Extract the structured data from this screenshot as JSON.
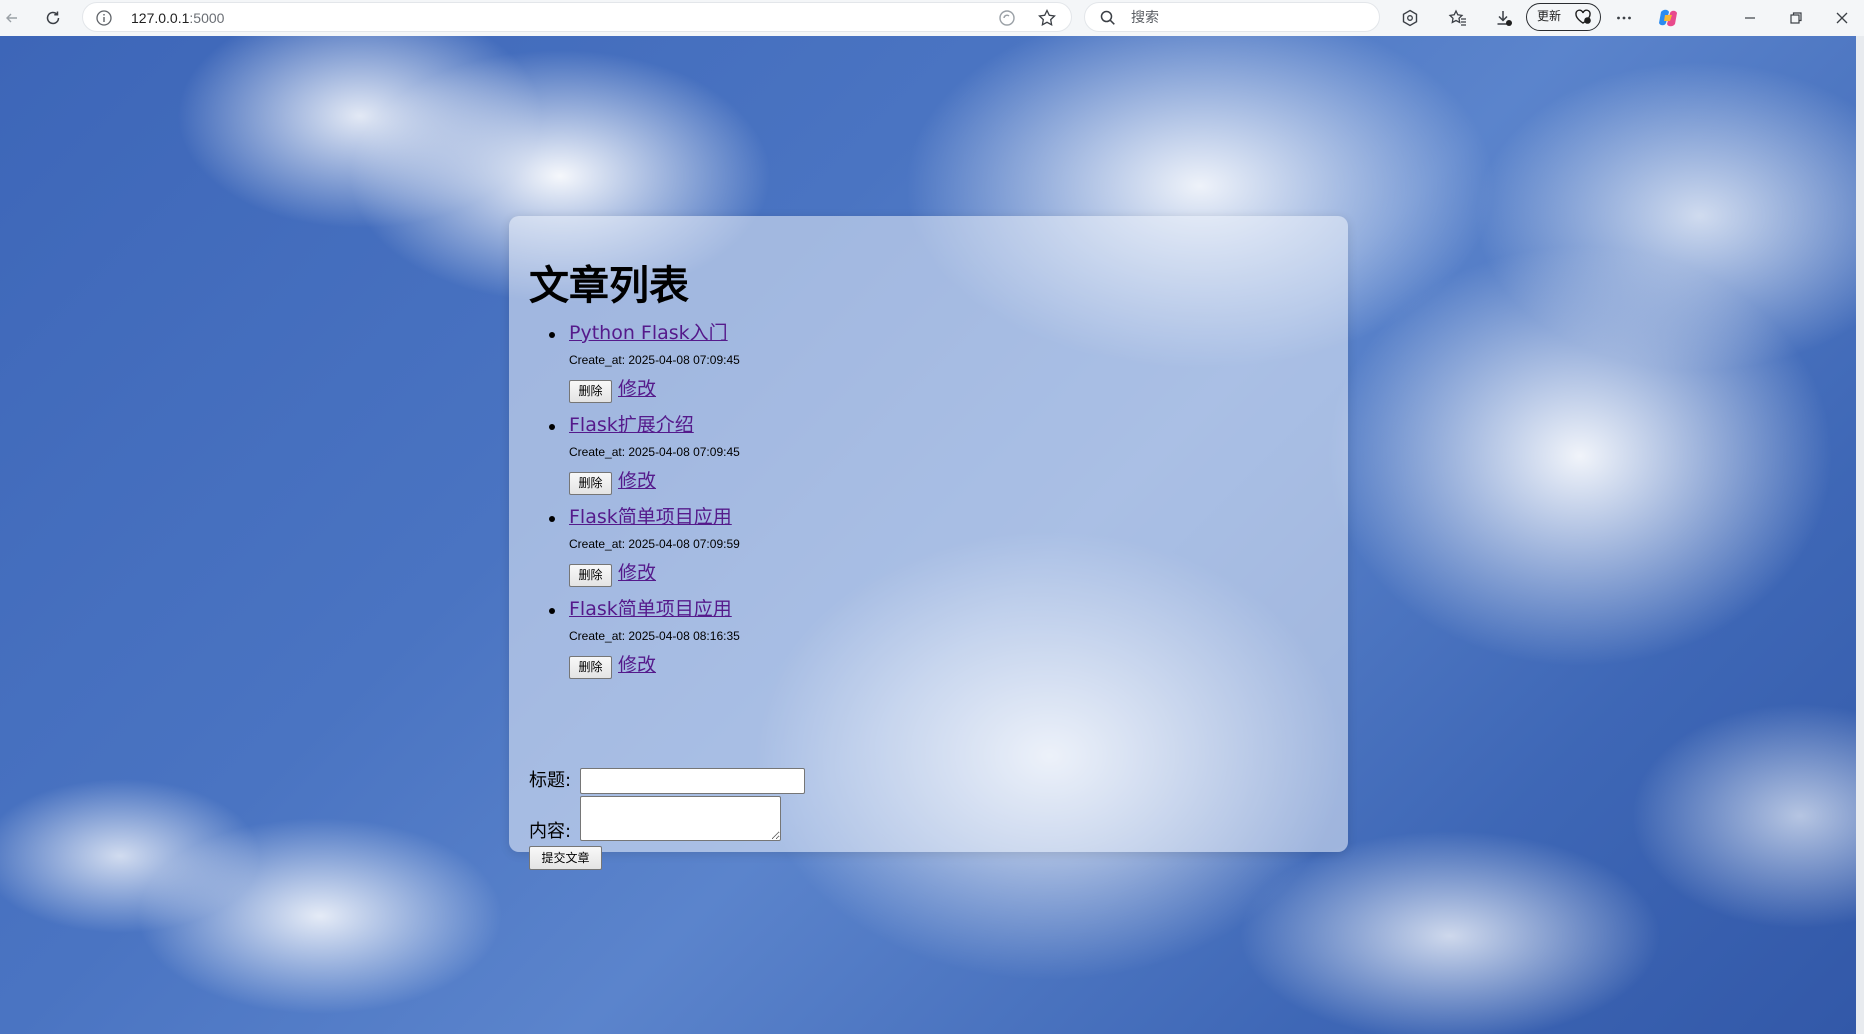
{
  "browser": {
    "address": {
      "host": "127.0.0.1",
      "port": ":5000"
    },
    "search_placeholder": "搜索",
    "update_label": "更新"
  },
  "page": {
    "title": "文章列表",
    "articles": [
      {
        "title": "Python Flask入门",
        "created_at": "Create_at: 2025-04-08 07:09:45",
        "delete_label": "删除",
        "edit_label": "修改"
      },
      {
        "title": "Flask扩展介绍",
        "created_at": "Create_at: 2025-04-08 07:09:45",
        "delete_label": "删除",
        "edit_label": "修改"
      },
      {
        "title": "Flask简单项目应用",
        "created_at": "Create_at: 2025-04-08 07:09:59",
        "delete_label": "删除",
        "edit_label": "修改"
      },
      {
        "title": "Flask简单项目应用",
        "created_at": "Create_at: 2025-04-08 08:16:35",
        "delete_label": "删除",
        "edit_label": "修改"
      }
    ],
    "form": {
      "title_label": "标题:",
      "title_value": "",
      "content_label": "内容:",
      "content_value": "",
      "submit_label": "提交文章"
    }
  },
  "colors": {
    "visited_link": "#551a8b",
    "sky": "#4a74c2"
  }
}
